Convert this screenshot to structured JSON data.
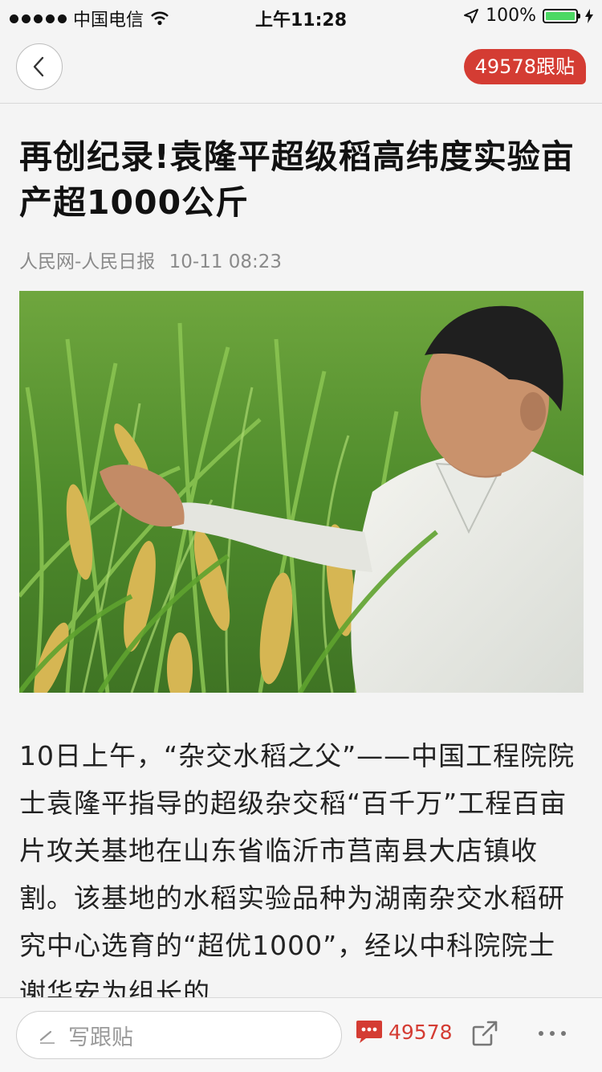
{
  "status_bar": {
    "carrier": "中国电信",
    "time": "上午11:28",
    "battery_percent": "100%"
  },
  "nav": {
    "comment_badge": "49578跟贴"
  },
  "article": {
    "headline": "再创纪录!袁隆平超级稻高纬度实验亩产超1000公斤",
    "source": "人民网-人民日报",
    "date": "10-11 08:23",
    "body": "10日上午，“杂交水稻之父”——中国工程院院士袁隆平指导的超级杂交稻“百千万”工程百亩片攻关基地在山东省临沂市莒南县大店镇收割。该基地的水稻实验品种为湖南杂交水稻研究中心选育的“超优1000”，经以中科院院士谢华安为组长的"
  },
  "toolbar": {
    "comment_placeholder": "写跟贴",
    "comment_count": "49578"
  },
  "colors": {
    "accent": "#d43c33",
    "battery": "#4cd964"
  },
  "icons": [
    "wifi-icon",
    "location-arrow-icon",
    "battery-icon",
    "charging-icon",
    "back-chevron-icon",
    "pencil-icon",
    "comment-bubble-icon",
    "share-icon",
    "more-icon"
  ]
}
